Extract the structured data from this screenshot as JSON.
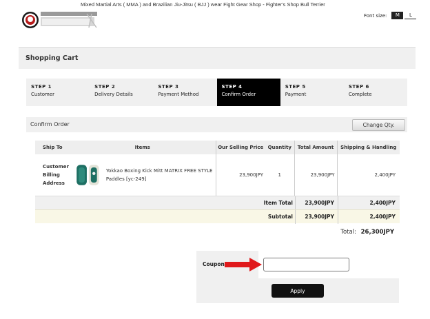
{
  "header": {
    "title": "Mixed Martial Arts ( MMA ) and Brazilian Jiu-Jitsu ( BJJ ) wear Fight Gear Shop - Fighter's Shop Bull Terrier",
    "font_size_label": "Font size:",
    "font_size_options": [
      "M",
      "L"
    ]
  },
  "cart": {
    "title": "Shopping Cart"
  },
  "steps": [
    {
      "num": "STEP 1",
      "label": "Customer",
      "active": false
    },
    {
      "num": "STEP 2",
      "label": "Delivery Details",
      "active": false
    },
    {
      "num": "STEP 3",
      "label": "Payment Method",
      "active": false
    },
    {
      "num": "STEP 4",
      "label": "Confirm Order",
      "active": true
    },
    {
      "num": "STEP 5",
      "label": "Payment",
      "active": false
    },
    {
      "num": "STEP 6",
      "label": "Complete",
      "active": false
    }
  ],
  "confirm": {
    "title": "Confirm Order",
    "change_qty_label": "Change Qty."
  },
  "table": {
    "headers": [
      "Ship To",
      "Items",
      "Our Selling Price",
      "Quantity",
      "Total Amount",
      "Shipping & Handling"
    ],
    "row": {
      "ship_to": "Customer Billing Address",
      "item_name": "Yokkao Boxing Kick Mitt MATRIX FREE STYLE Paddles [yc-249]",
      "price": "23,900JPY",
      "quantity": "1",
      "total_amount": "23,900JPY",
      "shipping": "2,400JPY"
    },
    "item_total_label": "Item Total",
    "item_total_amount": "23,900JPY",
    "item_total_shipping": "2,400JPY",
    "subtotal_label": "Subtotal",
    "subtotal_amount": "23,900JPY",
    "subtotal_shipping": "2,400JPY"
  },
  "grand_total": {
    "label": "Total:",
    "value": "26,300JPY"
  },
  "coupon": {
    "label": "Coupon",
    "value": "",
    "apply_label": "Apply"
  },
  "colors": {
    "active_step": "#000000",
    "arrow": "#e0191b",
    "subtotal_bg": "#f9f7e6"
  }
}
